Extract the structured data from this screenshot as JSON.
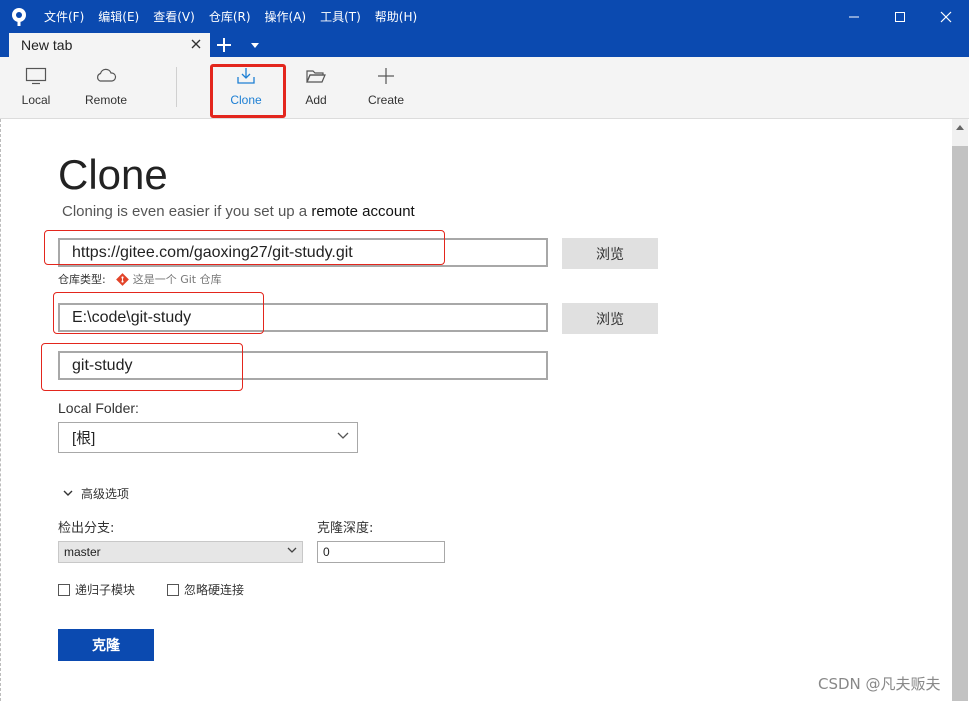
{
  "window": {
    "menu": [
      "文件(F)",
      "编辑(E)",
      "查看(V)",
      "仓库(R)",
      "操作(A)",
      "工具(T)",
      "帮助(H)"
    ]
  },
  "tabs": {
    "active_label": "New tab"
  },
  "toolbar": {
    "local": "Local",
    "remote": "Remote",
    "clone": "Clone",
    "add": "Add",
    "create": "Create"
  },
  "clone_page": {
    "title": "Clone",
    "subtitle_prefix": "Cloning is even easier if you set up a",
    "subtitle_link": "remote account",
    "source_url": "https://gitee.com/gaoxing27/git-study.git",
    "browse_label": "浏览",
    "repo_type_label": "仓库类型:",
    "repo_type_value": "这是一个 Git 仓库",
    "destination_path": "E:\\code\\git-study",
    "repo_name": "git-study",
    "local_folder_label": "Local Folder:",
    "local_folder_value": "[根]",
    "advanced_label": "高级选项",
    "checkout_branch_label": "检出分支:",
    "checkout_branch_value": "master",
    "clone_depth_label": "克隆深度:",
    "clone_depth_value": "0",
    "recurse_submodules_label": "递归子模块",
    "ignore_hardlinks_label": "忽略硬连接",
    "clone_button": "克隆"
  },
  "watermark": "CSDN @凡夫贩夫",
  "colors": {
    "titlebar": "#0b4ab0",
    "accent": "#1d7fd4",
    "highlight": "#e3261d",
    "git_icon": "#e24329"
  }
}
